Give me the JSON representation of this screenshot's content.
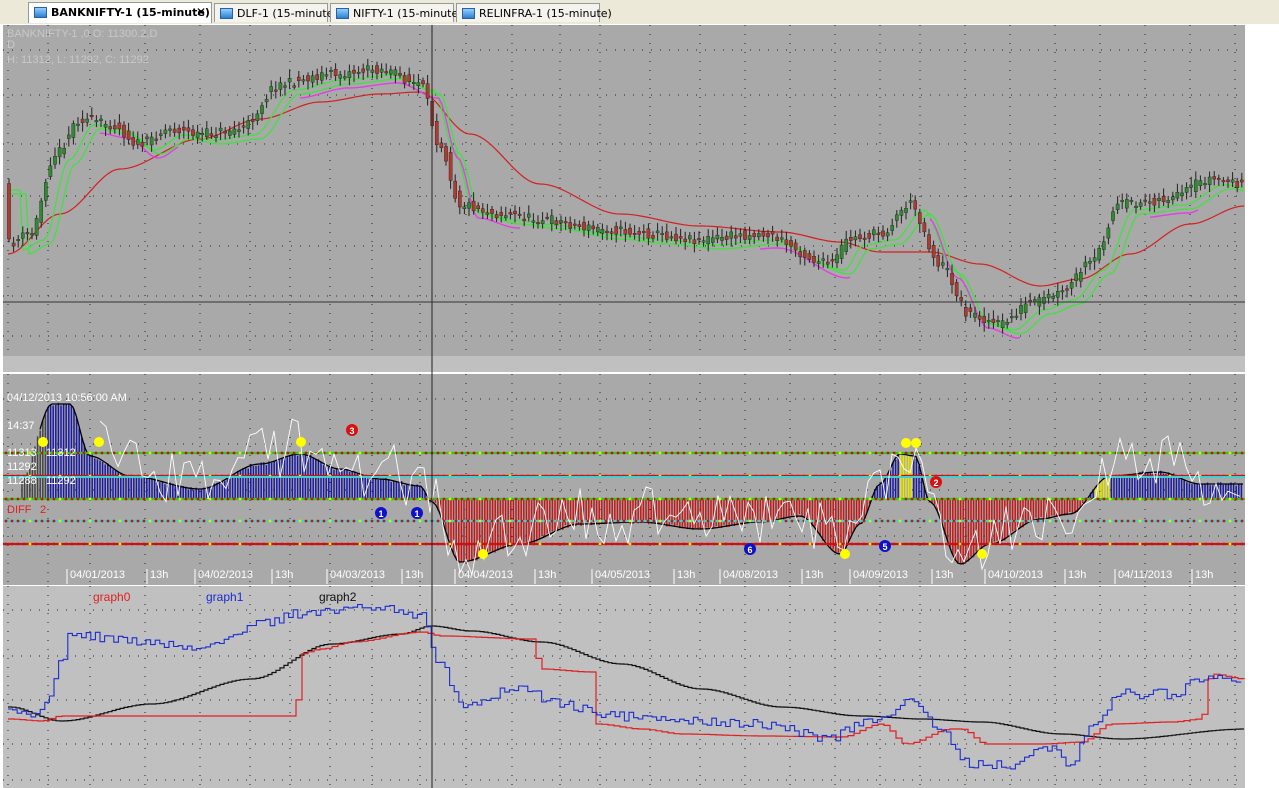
{
  "tabs": [
    {
      "label": "BANKNIFTY-1 (15-minute)",
      "active": true,
      "close": "✕"
    },
    {
      "label": "DLF-1 (15-minute)",
      "active": false
    },
    {
      "label": "NIFTY-1 (15-minute)",
      "active": false
    },
    {
      "label": "RELINFRA-1 (15-minute)",
      "active": false
    }
  ],
  "colors": {
    "pane_bg": "#a9a9a9",
    "bull_candle": "#2e8b2e",
    "bear_candle": "#b03a2e",
    "ma_red": "#d42020",
    "band_green": "#3ee33e",
    "band_magenta": "#e040e0",
    "hist_blue": "#1a1aa0",
    "hist_red": "#c01818",
    "level_green": "#22cc22",
    "level_cyan": "#40d0d0",
    "level_red": "#d01010",
    "level_yellow": "#e8e800",
    "graph0": "#e02020",
    "graph1": "#1a2cd0",
    "graph2": "#101010"
  },
  "price_pane": {
    "header_line1": "BANKNIFTY-1 ,0 O: 11300.2,D",
    "header_line2": "D",
    "header_line3": "H: 11312, L: 11292, C: 11292"
  },
  "indicator_pane": {
    "timestamp": "04/12/2013 10:56:00 AM",
    "time_label": "14:37",
    "level_labels": [
      {
        "left": "11313",
        "right": "11312"
      },
      {
        "left": "11292",
        "right": ""
      },
      {
        "left": "11288",
        "right": "11292"
      }
    ],
    "diff_label": "DIFF",
    "diff_value": "2",
    "markers": [
      {
        "text": "3",
        "color": "red"
      },
      {
        "text": "2",
        "color": "red"
      },
      {
        "text": "1",
        "color": "blue"
      },
      {
        "text": "1",
        "color": "blue"
      },
      {
        "text": "6",
        "color": "blue"
      },
      {
        "text": "5",
        "color": "blue"
      }
    ]
  },
  "x_axis_labels": [
    "04/01/2013",
    "13h",
    "04/02/2013",
    "13h",
    "04/03/2013",
    "13h",
    "04/04/2013",
    "13h",
    "04/05/2013",
    "13h",
    "04/08/2013",
    "13h",
    "04/09/2013",
    "13h",
    "04/10/2013",
    "13h",
    "04/11/2013",
    "13h"
  ],
  "chart_data": [
    {
      "type": "line",
      "pane": "price",
      "title": "BANKNIFTY-1 (15-minute)",
      "series_kind": "candlestick with moving averages",
      "x": [
        "04/01/2013",
        "04/02/2013",
        "04/03/2013",
        "04/04/2013",
        "04/05/2013",
        "04/08/2013",
        "04/09/2013",
        "04/10/2013",
        "04/11/2013",
        "04/12/2013"
      ],
      "ohlc_values": [
        11070,
        11170,
        11230,
        11050,
        11025,
        11010,
        11080,
        10960,
        11080,
        11110
      ],
      "ohlc_snapshot": {
        "open": 11300.2,
        "high": 11312,
        "low": 11292,
        "close": 11292
      }
    },
    {
      "type": "bar",
      "pane": "indicator",
      "series": [
        {
          "name": "DIFF",
          "values": [
            22,
            10,
            16,
            14,
            12,
            4,
            -30,
            -36,
            -25,
            -20,
            -38,
            22,
            -40,
            -30,
            10,
            8
          ]
        }
      ],
      "levels": [
        11313,
        11312,
        11292,
        11288
      ]
    },
    {
      "type": "line",
      "pane": "graphs",
      "series": [
        {
          "name": "graph0",
          "values": [
            11000,
            11000,
            11010,
            11170,
            11180,
            11060,
            11030,
            11000,
            11010,
            11130
          ]
        },
        {
          "name": "graph1",
          "values": [
            11020,
            11180,
            11240,
            11060,
            11030,
            11020,
            11080,
            10960,
            11090,
            11110
          ]
        },
        {
          "name": "graph2",
          "values": [
            11010,
            11080,
            11190,
            11210,
            11160,
            11100,
            11070,
            11040,
            11030,
            11040
          ]
        }
      ]
    }
  ]
}
